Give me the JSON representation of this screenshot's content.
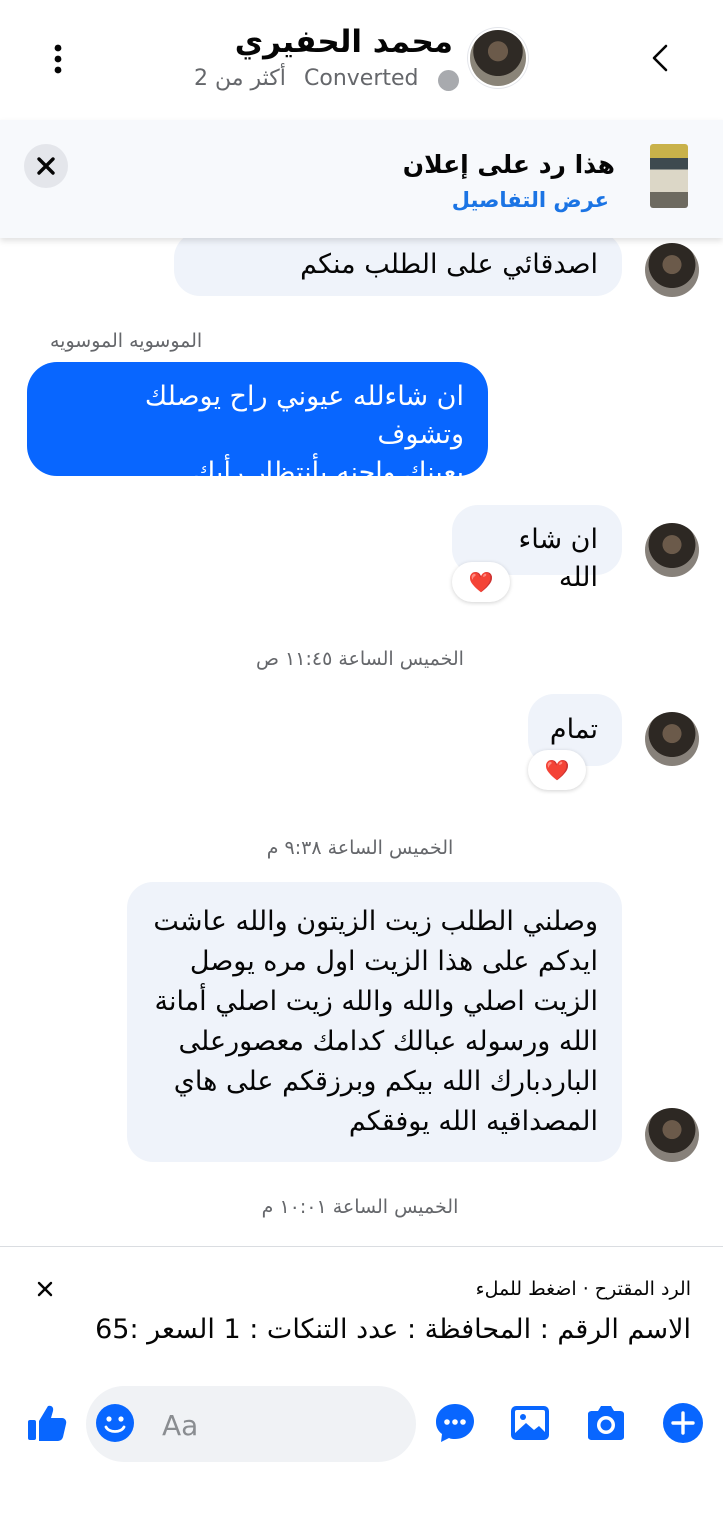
{
  "colors": {
    "accent": "#0866ff",
    "link": "#1b74e4",
    "incoming_bubble": "#eff3fa",
    "heart": "#f02849"
  },
  "header": {
    "title": "محمد الحفيري",
    "status": "Converted",
    "last_active": "أكثر من 2"
  },
  "ad_banner": {
    "title": "هذا رد على إعلان",
    "link": "عرض التفاصيل"
  },
  "messages": {
    "m1": "اصدقائي على الطلب منكم",
    "m2_sender": "الموسويه الموسويه",
    "m2_line1": "ان شاءلله عيوني راح يوصلك وتشوف",
    "m2_line2": "بعينك واحنه بأنتظار رأيك",
    "m3": "ان شاء الله",
    "m3_reaction": "❤️",
    "ts1": "الخميس الساعة ١١:٤٥ ص",
    "m4": "تمام",
    "m4_reaction": "❤️",
    "ts2": "الخميس الساعة ٩:٣٨ م",
    "m5_line1": "وصلني الطلب زيت الزيتون والله عاشت",
    "m5_line2": "ايدكم على هذا الزيت اول مره يوصل",
    "m5_line3": "الزيت اصلي  والله والله زيت اصلي أمانة",
    "m5_line4": "الله ورسوله عبالك كدامك معصورعلى",
    "m5_line5": "الباردبارك الله بيكم وبرزقكم على هاي",
    "m5_line6": "المصداقيه الله يوفقكم",
    "ts3": "الخميس الساعة ١٠:٠١ م"
  },
  "suggested_reply": {
    "label": "الرد المقترح · اضغط للملء",
    "text": "الاسم الرقم : المحافظة : عدد التنكات : 1 السعر :65"
  },
  "composer": {
    "placeholder": "Aa",
    "icons": [
      "like-icon",
      "emoji-icon",
      "chat-bubble-icon",
      "gallery-icon",
      "camera-icon",
      "add-icon"
    ]
  }
}
